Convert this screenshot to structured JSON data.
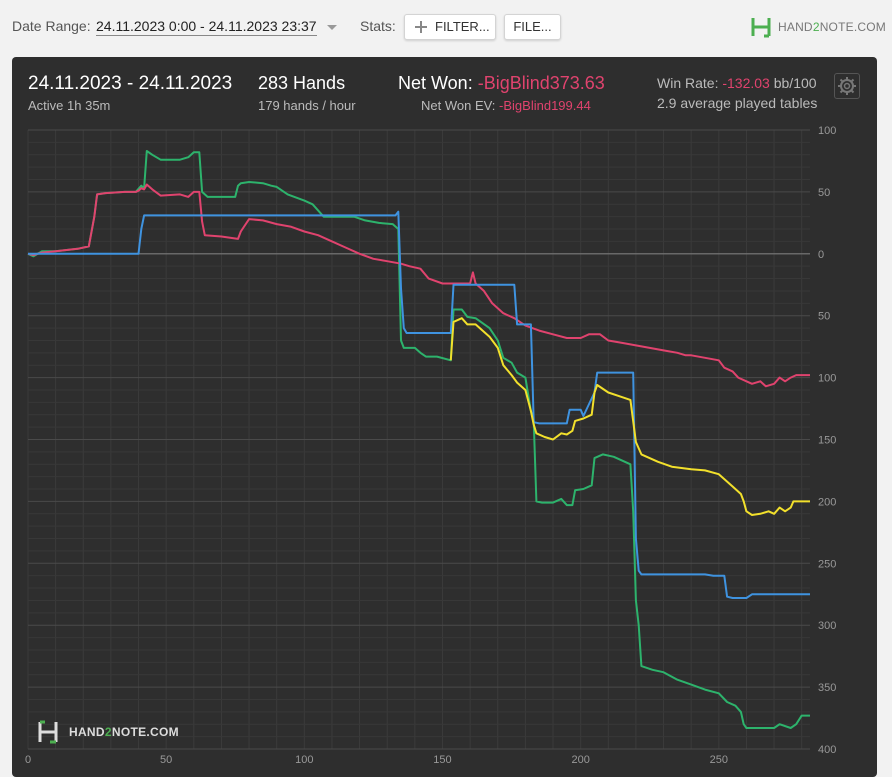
{
  "toolbar": {
    "date_range_label": "Date Range:",
    "date_range_value": "24.11.2023 0:00 - 24.11.2023 23:37",
    "stats_label": "Stats:",
    "filter_label": "FILTER...",
    "file_label": "FILE...",
    "logo_pre": "HAND",
    "logo_two": "2",
    "logo_post": "NOTE.COM"
  },
  "header": {
    "date": "24.11.2023 - 24.11.2023",
    "active": "Active 1h 35m",
    "hands": "283 Hands",
    "hands_per_hour": "179 hands / hour",
    "net_won_label": "Net Won:",
    "net_won_value": "-BigBlind373.63",
    "net_won_ev_label": "Net Won  EV:",
    "net_won_ev_value": "-BigBlind199.44",
    "win_rate_label": "Win Rate:",
    "win_rate_value": "-132.03",
    "win_rate_unit": "bb/100",
    "tables": "2.9 average played tables"
  },
  "watermark": {
    "pre": "HAND",
    "two": "2",
    "post": "NOTE.COM"
  },
  "colors": {
    "green": "#2db36c",
    "red": "#e0436e",
    "blue": "#3f93e0",
    "yellow": "#f2e02c",
    "accent_red": "#e0436e",
    "panel_bg": "#2e2e2e"
  },
  "chart_data": {
    "type": "line",
    "xlim": [
      0,
      283
    ],
    "ylim": [
      -400,
      100
    ],
    "x_ticks": [
      0,
      50,
      100,
      150,
      200,
      250
    ],
    "y_ticks": [
      100,
      50,
      0,
      50,
      100,
      150,
      200,
      250,
      300,
      350,
      400
    ],
    "y_tick_values": [
      100,
      50,
      0,
      -50,
      -100,
      -150,
      -200,
      -250,
      -300,
      -350,
      -400
    ],
    "grid": true,
    "series": [
      {
        "color": "#2db36c",
        "points": [
          [
            0,
            0
          ],
          [
            2,
            -2
          ],
          [
            5,
            2
          ],
          [
            10,
            2
          ],
          [
            18,
            4
          ],
          [
            22,
            6
          ],
          [
            24,
            30
          ],
          [
            25,
            48
          ],
          [
            28,
            49
          ],
          [
            35,
            50
          ],
          [
            39,
            50
          ],
          [
            41,
            55
          ],
          [
            42,
            53
          ],
          [
            43,
            83
          ],
          [
            45,
            80
          ],
          [
            48,
            76
          ],
          [
            55,
            76
          ],
          [
            58,
            78
          ],
          [
            60,
            82
          ],
          [
            62,
            82
          ],
          [
            63,
            50
          ],
          [
            65,
            46
          ],
          [
            70,
            46
          ],
          [
            75,
            46
          ],
          [
            76,
            55
          ],
          [
            77,
            57
          ],
          [
            80,
            58
          ],
          [
            85,
            57
          ],
          [
            88,
            55
          ],
          [
            90,
            54
          ],
          [
            94,
            48
          ],
          [
            100,
            43
          ],
          [
            103,
            40
          ],
          [
            107,
            30
          ],
          [
            110,
            30
          ],
          [
            115,
            30
          ],
          [
            118,
            30
          ],
          [
            122,
            27
          ],
          [
            127,
            25
          ],
          [
            132,
            24
          ],
          [
            134,
            20
          ],
          [
            135,
            -70
          ],
          [
            136,
            -76
          ],
          [
            140,
            -76
          ],
          [
            142,
            -80
          ],
          [
            144,
            -83
          ],
          [
            148,
            -83
          ],
          [
            153,
            -86
          ],
          [
            154,
            -45
          ],
          [
            157,
            -45
          ],
          [
            159,
            -51
          ],
          [
            162,
            -52
          ],
          [
            167,
            -60
          ],
          [
            170,
            -70
          ],
          [
            172,
            -84
          ],
          [
            175,
            -88
          ],
          [
            177,
            -96
          ],
          [
            180,
            -100
          ],
          [
            182,
            -127
          ],
          [
            183,
            -135
          ],
          [
            184,
            -200
          ],
          [
            186,
            -201
          ],
          [
            190,
            -201
          ],
          [
            193,
            -198
          ],
          [
            195,
            -203
          ],
          [
            197,
            -203
          ],
          [
            198,
            -191
          ],
          [
            201,
            -190
          ],
          [
            204,
            -187
          ],
          [
            205,
            -165
          ],
          [
            208,
            -162
          ],
          [
            212,
            -164
          ],
          [
            216,
            -168
          ],
          [
            218,
            -170
          ],
          [
            219,
            -208
          ],
          [
            220,
            -280
          ],
          [
            221,
            -300
          ],
          [
            222,
            -333
          ],
          [
            226,
            -336
          ],
          [
            230,
            -338
          ],
          [
            235,
            -344
          ],
          [
            240,
            -348
          ],
          [
            245,
            -352
          ],
          [
            250,
            -355
          ],
          [
            253,
            -362
          ],
          [
            256,
            -365
          ],
          [
            258,
            -370
          ],
          [
            259,
            -380
          ],
          [
            260,
            -383
          ],
          [
            270,
            -383
          ],
          [
            272,
            -380
          ],
          [
            276,
            -383
          ],
          [
            278,
            -380
          ],
          [
            280,
            -373
          ],
          [
            283,
            -373
          ]
        ]
      },
      {
        "color": "#e0436e",
        "points": [
          [
            0,
            0
          ],
          [
            2,
            -1
          ],
          [
            5,
            1
          ],
          [
            10,
            2
          ],
          [
            18,
            4
          ],
          [
            22,
            6
          ],
          [
            24,
            30
          ],
          [
            25,
            48
          ],
          [
            28,
            49
          ],
          [
            35,
            50
          ],
          [
            39,
            50
          ],
          [
            40,
            51
          ],
          [
            41,
            53
          ],
          [
            42,
            52
          ],
          [
            43,
            56
          ],
          [
            45,
            52
          ],
          [
            48,
            47
          ],
          [
            55,
            48
          ],
          [
            58,
            46
          ],
          [
            60,
            50
          ],
          [
            62,
            50
          ],
          [
            63,
            26
          ],
          [
            64,
            15
          ],
          [
            70,
            14
          ],
          [
            76,
            12
          ],
          [
            77,
            18
          ],
          [
            80,
            28
          ],
          [
            85,
            27
          ],
          [
            90,
            24
          ],
          [
            95,
            22
          ],
          [
            100,
            18
          ],
          [
            105,
            15
          ],
          [
            110,
            10
          ],
          [
            115,
            5
          ],
          [
            120,
            0
          ],
          [
            125,
            -4
          ],
          [
            130,
            -6
          ],
          [
            135,
            -8
          ],
          [
            138,
            -10
          ],
          [
            142,
            -12
          ],
          [
            145,
            -20
          ],
          [
            150,
            -24
          ],
          [
            155,
            -24
          ],
          [
            160,
            -24
          ],
          [
            161,
            -15
          ],
          [
            162,
            -24
          ],
          [
            165,
            -30
          ],
          [
            168,
            -40
          ],
          [
            172,
            -48
          ],
          [
            176,
            -52
          ],
          [
            180,
            -58
          ],
          [
            185,
            -62
          ],
          [
            190,
            -65
          ],
          [
            195,
            -68
          ],
          [
            200,
            -68
          ],
          [
            203,
            -65
          ],
          [
            207,
            -65
          ],
          [
            210,
            -70
          ],
          [
            215,
            -72
          ],
          [
            220,
            -74
          ],
          [
            225,
            -76
          ],
          [
            230,
            -78
          ],
          [
            235,
            -80
          ],
          [
            238,
            -82
          ],
          [
            240,
            -82
          ],
          [
            245,
            -84
          ],
          [
            250,
            -86
          ],
          [
            252,
            -92
          ],
          [
            255,
            -95
          ],
          [
            257,
            -100
          ],
          [
            260,
            -103
          ],
          [
            262,
            -105
          ],
          [
            265,
            -103
          ],
          [
            267,
            -107
          ],
          [
            270,
            -105
          ],
          [
            272,
            -100
          ],
          [
            274,
            -103
          ],
          [
            276,
            -100
          ],
          [
            278,
            -98
          ],
          [
            283,
            -98
          ]
        ]
      },
      {
        "color": "#3f93e0",
        "points": [
          [
            0,
            0
          ],
          [
            40,
            0
          ],
          [
            41,
            20
          ],
          [
            42,
            31
          ],
          [
            60,
            31
          ],
          [
            100,
            31
          ],
          [
            133,
            31
          ],
          [
            134,
            34
          ],
          [
            135,
            -28
          ],
          [
            136,
            -60
          ],
          [
            137,
            -64
          ],
          [
            140,
            -64
          ],
          [
            150,
            -64
          ],
          [
            153,
            -64
          ],
          [
            154,
            -25
          ],
          [
            160,
            -25
          ],
          [
            165,
            -25
          ],
          [
            170,
            -25
          ],
          [
            176,
            -25
          ],
          [
            177,
            -57
          ],
          [
            180,
            -57
          ],
          [
            182,
            -57
          ],
          [
            183,
            -136
          ],
          [
            185,
            -137
          ],
          [
            190,
            -137
          ],
          [
            195,
            -137
          ],
          [
            196,
            -126
          ],
          [
            200,
            -126
          ],
          [
            201,
            -131
          ],
          [
            205,
            -112
          ],
          [
            206,
            -96
          ],
          [
            210,
            -96
          ],
          [
            215,
            -96
          ],
          [
            219,
            -96
          ],
          [
            220,
            -230
          ],
          [
            221,
            -256
          ],
          [
            222,
            -259
          ],
          [
            230,
            -259
          ],
          [
            240,
            -259
          ],
          [
            245,
            -259
          ],
          [
            248,
            -260
          ],
          [
            252,
            -260
          ],
          [
            253,
            -277
          ],
          [
            255,
            -278
          ],
          [
            260,
            -278
          ],
          [
            262,
            -275
          ],
          [
            270,
            -275
          ],
          [
            283,
            -275
          ]
        ]
      },
      {
        "color": "#f2e02c",
        "points": [
          [
            153,
            -86
          ],
          [
            154,
            -55
          ],
          [
            157,
            -52
          ],
          [
            159,
            -57
          ],
          [
            162,
            -57
          ],
          [
            167,
            -67
          ],
          [
            170,
            -76
          ],
          [
            172,
            -90
          ],
          [
            175,
            -98
          ],
          [
            177,
            -104
          ],
          [
            180,
            -110
          ],
          [
            182,
            -127
          ],
          [
            183,
            -138
          ],
          [
            184,
            -145
          ],
          [
            187,
            -148
          ],
          [
            190,
            -150
          ],
          [
            193,
            -145
          ],
          [
            195,
            -146
          ],
          [
            197,
            -143
          ],
          [
            198,
            -135
          ],
          [
            201,
            -133
          ],
          [
            204,
            -130
          ],
          [
            205,
            -112
          ],
          [
            206,
            -106
          ],
          [
            210,
            -112
          ],
          [
            214,
            -115
          ],
          [
            218,
            -118
          ],
          [
            220,
            -152
          ],
          [
            222,
            -162
          ],
          [
            228,
            -168
          ],
          [
            233,
            -172
          ],
          [
            240,
            -174
          ],
          [
            245,
            -175
          ],
          [
            250,
            -178
          ],
          [
            252,
            -182
          ],
          [
            255,
            -188
          ],
          [
            258,
            -194
          ],
          [
            259,
            -200
          ],
          [
            260,
            -208
          ],
          [
            262,
            -211
          ],
          [
            265,
            -210
          ],
          [
            268,
            -208
          ],
          [
            270,
            -210
          ],
          [
            272,
            -205
          ],
          [
            274,
            -208
          ],
          [
            276,
            -205
          ],
          [
            277,
            -200
          ],
          [
            283,
            -200
          ]
        ]
      }
    ]
  }
}
